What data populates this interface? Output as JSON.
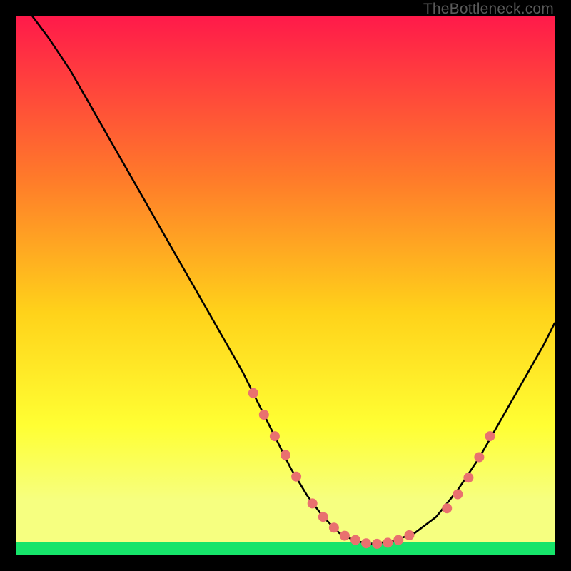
{
  "watermark": "TheBottleneck.com",
  "colors": {
    "gradient_top": "#ff1a4a",
    "gradient_mid1": "#ff7a2a",
    "gradient_mid2": "#ffd21a",
    "gradient_mid3": "#ffff33",
    "gradient_lowband": "#f6ff80",
    "gradient_green": "#16e46a",
    "curve": "#000000",
    "marker": "#e9716f",
    "background": "#000000"
  },
  "chart_data": {
    "type": "line",
    "title": "",
    "xlabel": "",
    "ylabel": "",
    "xlim": [
      0,
      100
    ],
    "ylim": [
      0,
      100
    ],
    "x": [
      3,
      6,
      10,
      14,
      18,
      22,
      26,
      30,
      34,
      38,
      42,
      45,
      48,
      51,
      54,
      57,
      60,
      63,
      66,
      70,
      74,
      78,
      82,
      86,
      90,
      94,
      98,
      100
    ],
    "values": [
      100,
      96,
      90,
      83,
      76,
      69,
      62,
      55,
      48,
      41,
      34,
      28,
      22,
      16,
      11,
      7,
      4,
      2.5,
      2,
      2.5,
      4,
      7,
      12,
      18,
      25,
      32,
      39,
      43
    ],
    "markers_x": [
      44,
      46,
      48,
      50,
      52,
      55,
      57,
      59,
      61,
      63,
      65,
      67,
      69,
      71,
      73,
      80,
      82,
      84,
      86,
      88
    ],
    "markers_y": [
      30,
      26,
      22,
      18.5,
      14.5,
      9.5,
      7,
      5,
      3.5,
      2.7,
      2.1,
      2,
      2.2,
      2.7,
      3.6,
      8.6,
      11.2,
      14.3,
      18.1,
      22
    ]
  }
}
